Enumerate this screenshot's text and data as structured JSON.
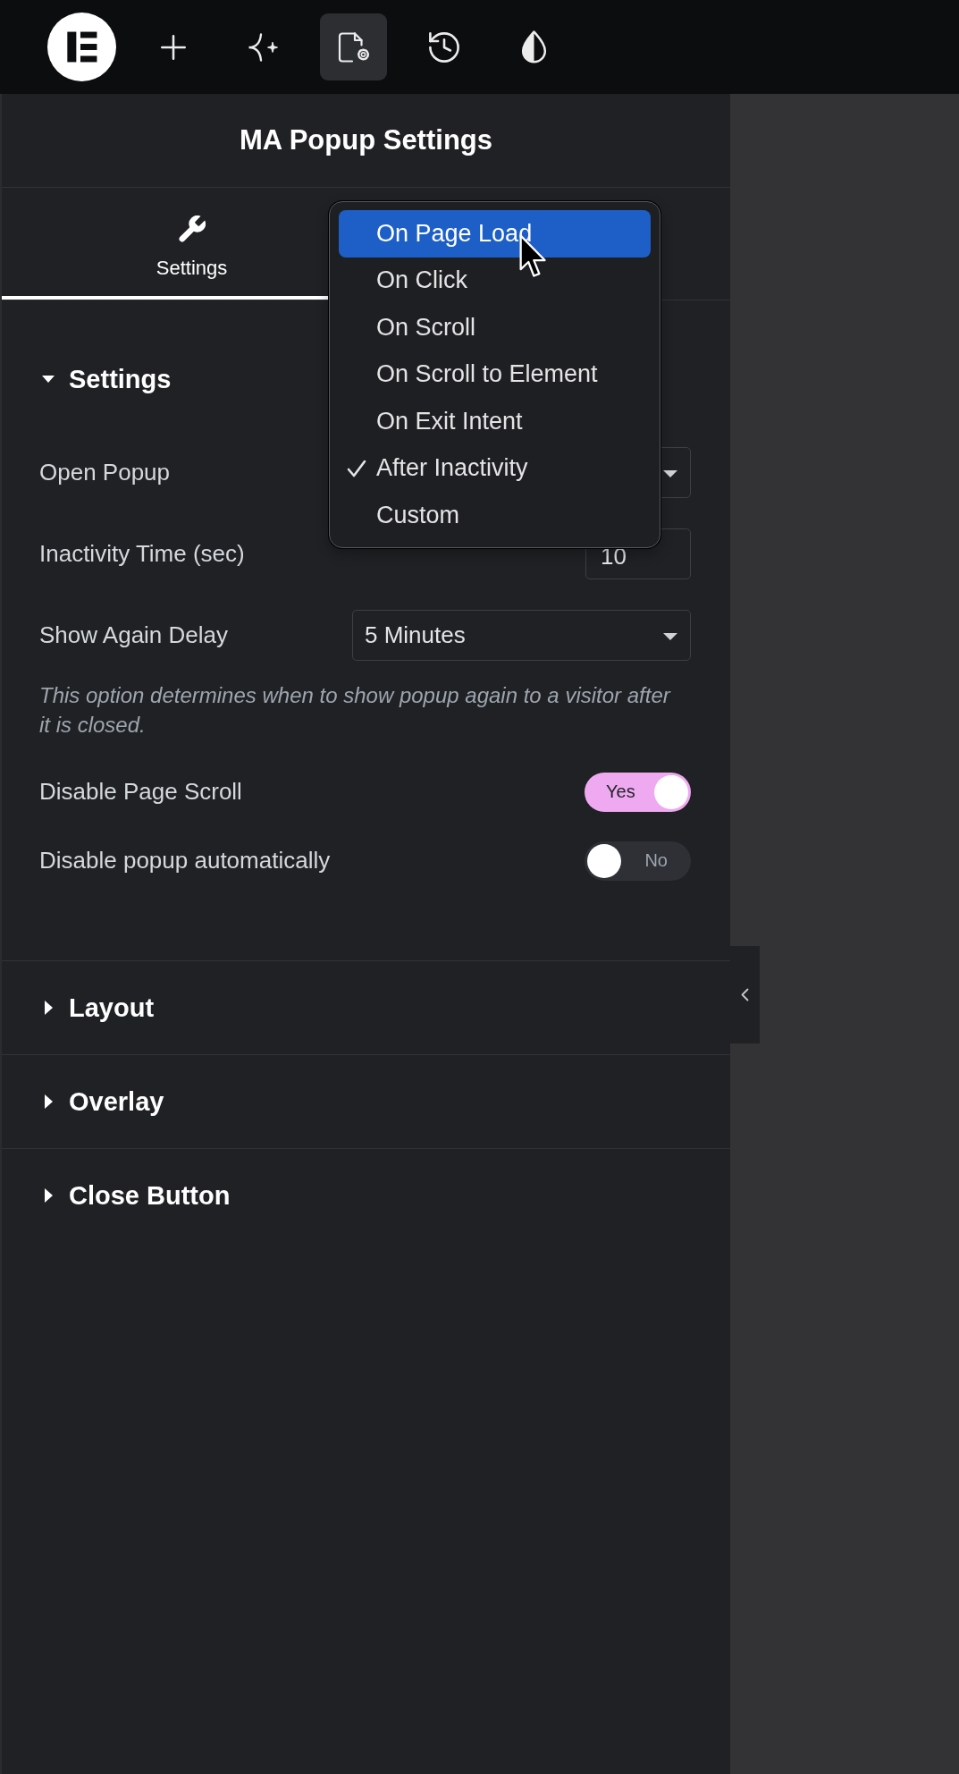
{
  "toolbar": {
    "buttons": [
      {
        "kind": "add",
        "selected": false
      },
      {
        "kind": "ai",
        "selected": false
      },
      {
        "kind": "settings",
        "selected": true
      },
      {
        "kind": "history",
        "selected": false
      },
      {
        "kind": "theme",
        "selected": false
      }
    ]
  },
  "panel": {
    "title": "MA Popup Settings",
    "tabs": [
      {
        "label": "Settings",
        "selected": true
      }
    ],
    "sections": [
      {
        "title": "Settings",
        "expanded": true,
        "controls": [
          {
            "kind": "select",
            "label": "Open Popup",
            "menu": {
              "options": [
                {
                  "label": "On Page Load",
                  "highlighted": true,
                  "selected": false
                },
                {
                  "label": "On Click",
                  "highlighted": false,
                  "selected": false
                },
                {
                  "label": "On Scroll",
                  "highlighted": false,
                  "selected": false
                },
                {
                  "label": "On Scroll to Element",
                  "highlighted": false,
                  "selected": false
                },
                {
                  "label": "On Exit Intent",
                  "highlighted": false,
                  "selected": false
                },
                {
                  "label": "After Inactivity",
                  "highlighted": false,
                  "selected": true
                },
                {
                  "label": "Custom",
                  "highlighted": false,
                  "selected": false
                }
              ]
            }
          },
          {
            "kind": "number",
            "label": "Inactivity Time (sec)",
            "value": "10"
          },
          {
            "kind": "select",
            "label": "Show Again Delay",
            "value": "5 Minutes",
            "description": "This option determines when to show popup again to a visitor after it is closed."
          },
          {
            "kind": "toggle",
            "label": "Disable Page Scroll",
            "on": true,
            "state_text": "Yes"
          },
          {
            "kind": "toggle",
            "label": "Disable popup automatically",
            "on": false,
            "state_text": "No"
          }
        ]
      },
      {
        "title": "Layout",
        "expanded": false
      },
      {
        "title": "Overlay",
        "expanded": false
      },
      {
        "title": "Close Button",
        "expanded": false
      }
    ]
  }
}
